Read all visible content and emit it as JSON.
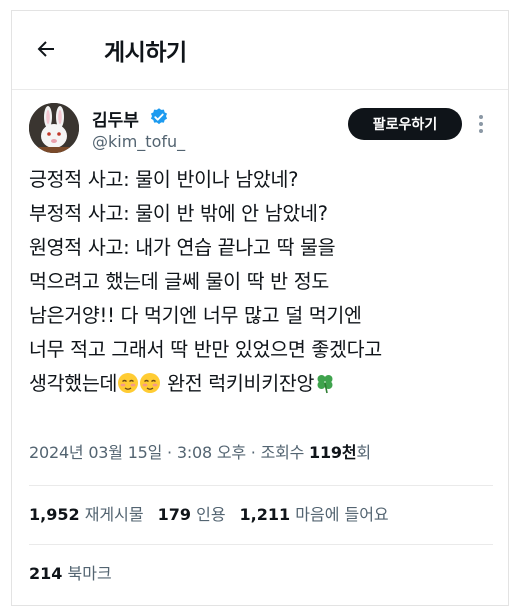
{
  "header": {
    "title": "게시하기",
    "back_icon": "arrow-left-icon"
  },
  "author": {
    "name": "김두부",
    "handle": "@kim_tofu_",
    "verified_icon": "verified-badge-icon",
    "verified_color": "#1d9bf0",
    "follow_label": "팔로우하기"
  },
  "post": {
    "lines": [
      "긍정적 사고: 물이 반이나 남았네?",
      "부정적 사고: 물이 반 밖에 안 남았네?",
      "원영적 사고: 내가 연습 끝나고 딱 물을",
      "먹으려고 했는데 글쎄 물이 딱 반 정도",
      "남은거양!! 다 먹기엔 너무 많고 덜 먹기엔",
      "너무 적고 그래서 딱 반만 있었으면 좋겠다고"
    ],
    "last_line_text": "생각했는데",
    "last_line_tail": " 완전 럭키비키잔앙",
    "emojis": [
      "blushing-smile-emoji",
      "blushing-smile-emoji",
      "four-leaf-clover-emoji"
    ]
  },
  "meta": {
    "date": "2024년 03월 15일",
    "sep": " · ",
    "time": "3:08 오후",
    "views_label": "조회수",
    "views_count": "119천",
    "views_suffix": "회"
  },
  "stats": {
    "reposts_count": "1,952",
    "reposts_label": "재게시물",
    "quotes_count": "179",
    "quotes_label": "인용",
    "likes_count": "1,211",
    "likes_label": "마음에 들어요"
  },
  "bookmarks": {
    "count": "214",
    "label": "북마크"
  }
}
